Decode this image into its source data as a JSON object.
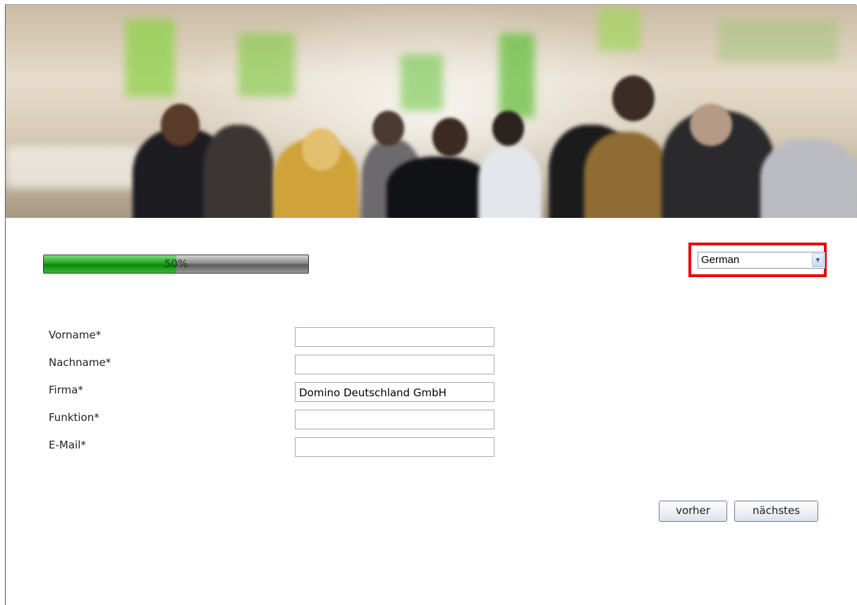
{
  "progress": {
    "value": 50,
    "label": "50%"
  },
  "language": {
    "selected": "German"
  },
  "form": {
    "fields": [
      {
        "label": "Vorname*",
        "value": ""
      },
      {
        "label": "Nachname*",
        "value": ""
      },
      {
        "label": "Firma*",
        "value": "Domino Deutschland GmbH"
      },
      {
        "label": "Funktion*",
        "value": ""
      },
      {
        "label": "E-Mail*",
        "value": ""
      }
    ]
  },
  "buttons": {
    "prev": "vorher",
    "next": "nächstes"
  },
  "colors": {
    "highlight": "#ea0000",
    "progress_fill": "#1a9e1a"
  }
}
